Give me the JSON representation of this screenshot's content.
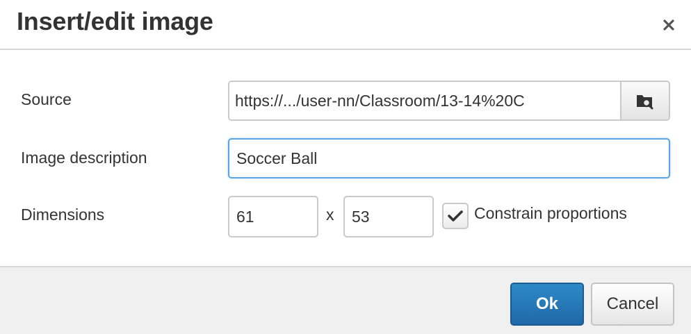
{
  "dialog": {
    "title": "Insert/edit image",
    "close_icon": "close-icon"
  },
  "form": {
    "source": {
      "label": "Source",
      "value": "https://.../user-nn/Classroom/13-14%20C",
      "browse_icon": "folder-search-icon"
    },
    "description": {
      "label": "Image description",
      "value": "Soccer Ball"
    },
    "dimensions": {
      "label": "Dimensions",
      "width": "61",
      "separator": "x",
      "height": "53",
      "constrain_label": "Constrain proportions",
      "constrain_checked": true
    }
  },
  "footer": {
    "ok_label": "Ok",
    "cancel_label": "Cancel"
  },
  "colors": {
    "primary": "#2168a8",
    "focus": "#59a5e5",
    "footer_bg": "#f0f0f0"
  }
}
